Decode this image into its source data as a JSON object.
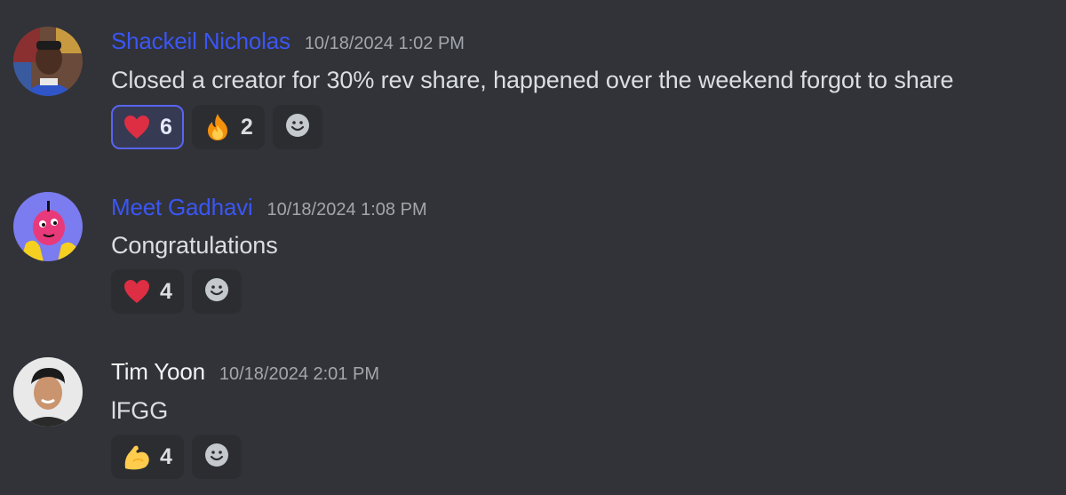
{
  "messages": [
    {
      "username": "Shackeil Nicholas",
      "name_color": "#3b56f5",
      "timestamp": "10/18/2024 1:02 PM",
      "content": "Closed a creator for 30% rev share, happened over the weekend forgot to share",
      "reactions": [
        {
          "emoji": "heart-icon",
          "count": "6",
          "selected": true
        },
        {
          "emoji": "fire-icon",
          "count": "2",
          "selected": false
        }
      ]
    },
    {
      "username": "Meet Gadhavi",
      "name_color": "#3b56f5",
      "timestamp": "10/18/2024 1:08 PM",
      "content": "Congratulations",
      "reactions": [
        {
          "emoji": "heart-icon",
          "count": "4",
          "selected": false
        }
      ]
    },
    {
      "username": "Tim Yoon",
      "name_color": "#f2f3f5",
      "timestamp": "10/18/2024 2:01 PM",
      "content": "lFGG",
      "reactions": [
        {
          "emoji": "flexed-biceps-icon",
          "count": "4",
          "selected": false
        }
      ]
    }
  ],
  "colors": {
    "background": "#313338",
    "reaction_bg": "#2b2d31",
    "reaction_selected_bg": "#373a53",
    "reaction_selected_border": "#5865f2",
    "text": "#dbdee1",
    "timestamp": "#a3a6ad"
  }
}
